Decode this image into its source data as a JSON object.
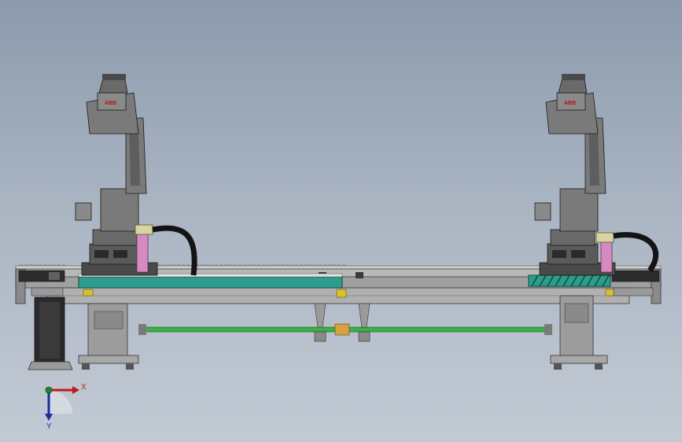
{
  "scene": {
    "robots": [
      {
        "id": "left",
        "brand": "ABB"
      },
      {
        "id": "right",
        "brand": "ABB"
      }
    ]
  },
  "triad": {
    "x_label": "X",
    "y_label": "Y",
    "colors": {
      "x": "#c0181c",
      "y": "#1c2c9c",
      "z": "#1a8c2a"
    }
  },
  "colors": {
    "teal_panel": "#2e9c8c",
    "cable": "#141414",
    "pink_bracket": "#d48cc0",
    "shaft": "#3cae48",
    "yellow_block": "#d8c030",
    "robot_gray": "#7a7a7a"
  }
}
